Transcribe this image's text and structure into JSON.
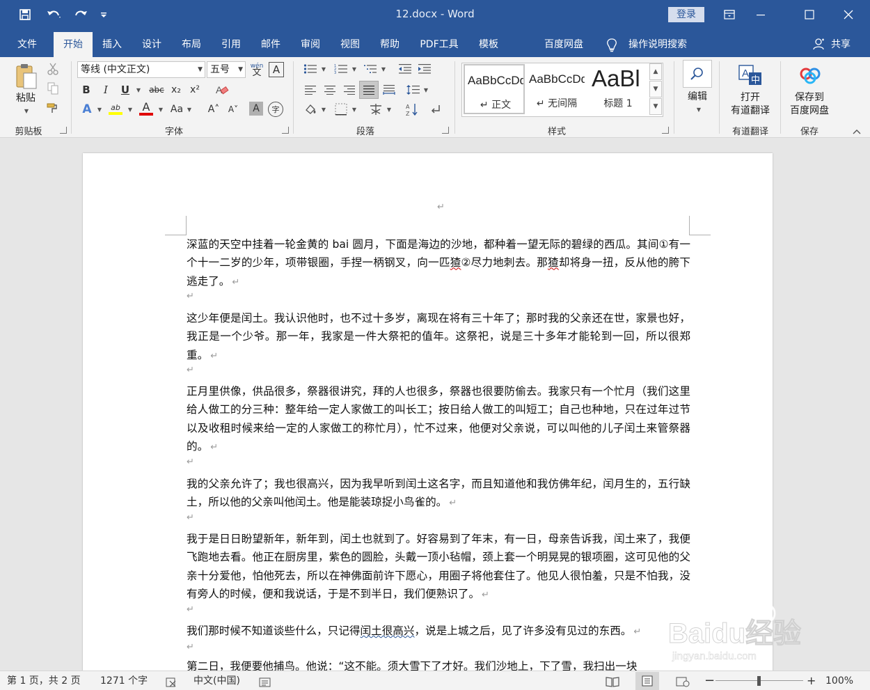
{
  "window": {
    "title": "12.docx  -  Word",
    "login_label": "登录"
  },
  "tabs": {
    "file": "文件",
    "home": "开始",
    "insert": "插入",
    "design": "设计",
    "layout": "布局",
    "references": "引用",
    "mailings": "邮件",
    "review": "审阅",
    "view": "视图",
    "help": "帮助",
    "pdf": "PDF工具",
    "template": "模板",
    "baidu": "百度网盘",
    "tellme": "操作说明搜索",
    "share": "共享"
  },
  "ribbon": {
    "clipboard": {
      "paste": "粘贴",
      "label": "剪贴板"
    },
    "font": {
      "name": "等线 (中文正文)",
      "size": "五号",
      "label": "字体",
      "bold": "B",
      "italic": "I",
      "underline": "U",
      "strike": "abc",
      "subscript": "x₂",
      "superscript": "x²",
      "text_effects": "A",
      "highlight": "ab",
      "font_color": "A",
      "change_case": "Aa",
      "grow": "A˄",
      "shrink": "A˅",
      "char_shading": "A",
      "enclose": "字",
      "phonetic": "wén",
      "border": "A",
      "font_color_hex": "#e00000",
      "highlight_hex": "#ffff00"
    },
    "paragraph": {
      "label": "段落"
    },
    "styles": {
      "label": "样式",
      "items": [
        {
          "preview": "AaBbCcDd",
          "name": "↵ 正文"
        },
        {
          "preview": "AaBbCcDd",
          "name": "↵ 无间隔"
        },
        {
          "preview": "AaBl",
          "name": "标题 1"
        }
      ]
    },
    "editing": {
      "label": "编辑"
    },
    "youdao": {
      "btn_line1": "打开",
      "btn_line2": "有道翻译",
      "label": "有道翻译"
    },
    "save": {
      "btn_line1": "保存到",
      "btn_line2": "百度网盘",
      "label": "保存"
    }
  },
  "document": {
    "top_mark": "↵",
    "pilcrow": "↵",
    "p1": {
      "a": "深蓝的天空中挂着一轮金黄的 bai 圆月，下面是海边的沙地，都种着一望无际的碧绿的西瓜。其间①有一个十一二岁的少年，项带银圈，手捏一柄钢叉，向一匹",
      "b": "猹",
      "c": "②尽力地刺去。那",
      "d": "猹",
      "e": "却将身一扭，反从他的胯下逃走了。"
    },
    "p2": "这少年便是闰土。我认识他时，也不过十多岁，离现在将有三十年了；那时我的父亲还在世，家景也好，我正是一个少爷。那一年，我家是一件大祭祀的值年。这祭祀，说是三十多年才能轮到一回，所以很郑重。",
    "p3": "正月里供像，供品很多，祭器很讲究，拜的人也很多，祭器也很要防偷去。我家只有一个忙月（我们这里给人做工的分三种：整年给一定人家做工的叫长工；按日给人做工的叫短工；自己也种地，只在过年过节以及收租时候来给一定的人家做工的称忙月），忙不过来，他便对父亲说，可以叫他的儿子闰土来管祭器的。",
    "p4": "我的父亲允许了；我也很高兴，因为我早听到闰土这名字，而且知道他和我仿佛年纪，闰月生的，五行缺土，所以他的父亲叫他闰土。他是能装琼捉小鸟雀的。",
    "p5": "我于是日日盼望新年，新年到，闰土也就到了。好容易到了年末，有一日，母亲告诉我，闰土来了，我便飞跑地去看。他正在厨房里，紫色的圆脸，头戴一顶小毡帽，颈上套一个明晃晃的银项圈，这可见他的父亲十分爱他，怕他死去，所以在神佛面前许下愿心，用圈子将他套住了。他见人很怕羞，只是不怕我，没有旁人的时候，便和我说话，于是不到半日，我们便熟识了。",
    "p6": {
      "a": "我们那时候不知道谈些什么，只记得",
      "b": "闰土很高兴",
      "c": "，说是上城之后，见了许多没有见过的东西。"
    },
    "p7": "第二日，我便要他捕鸟。他说：“这不能。须大雪下了才好。我们沙地上，下了雪，我扫出一块"
  },
  "status": {
    "page": "第 1 页，共 2 页",
    "words": "1271 个字",
    "language": "中文(中国)",
    "zoom": "100%",
    "zoom_minus": "−",
    "zoom_plus": "+"
  },
  "watermark": {
    "brand": "Baidu经验",
    "url": "jingyan.baidu.com"
  },
  "colors": {
    "accent": "#2b579a",
    "ribbon_bg": "#f3f3f3",
    "doc_bg": "#e6e6e6"
  }
}
